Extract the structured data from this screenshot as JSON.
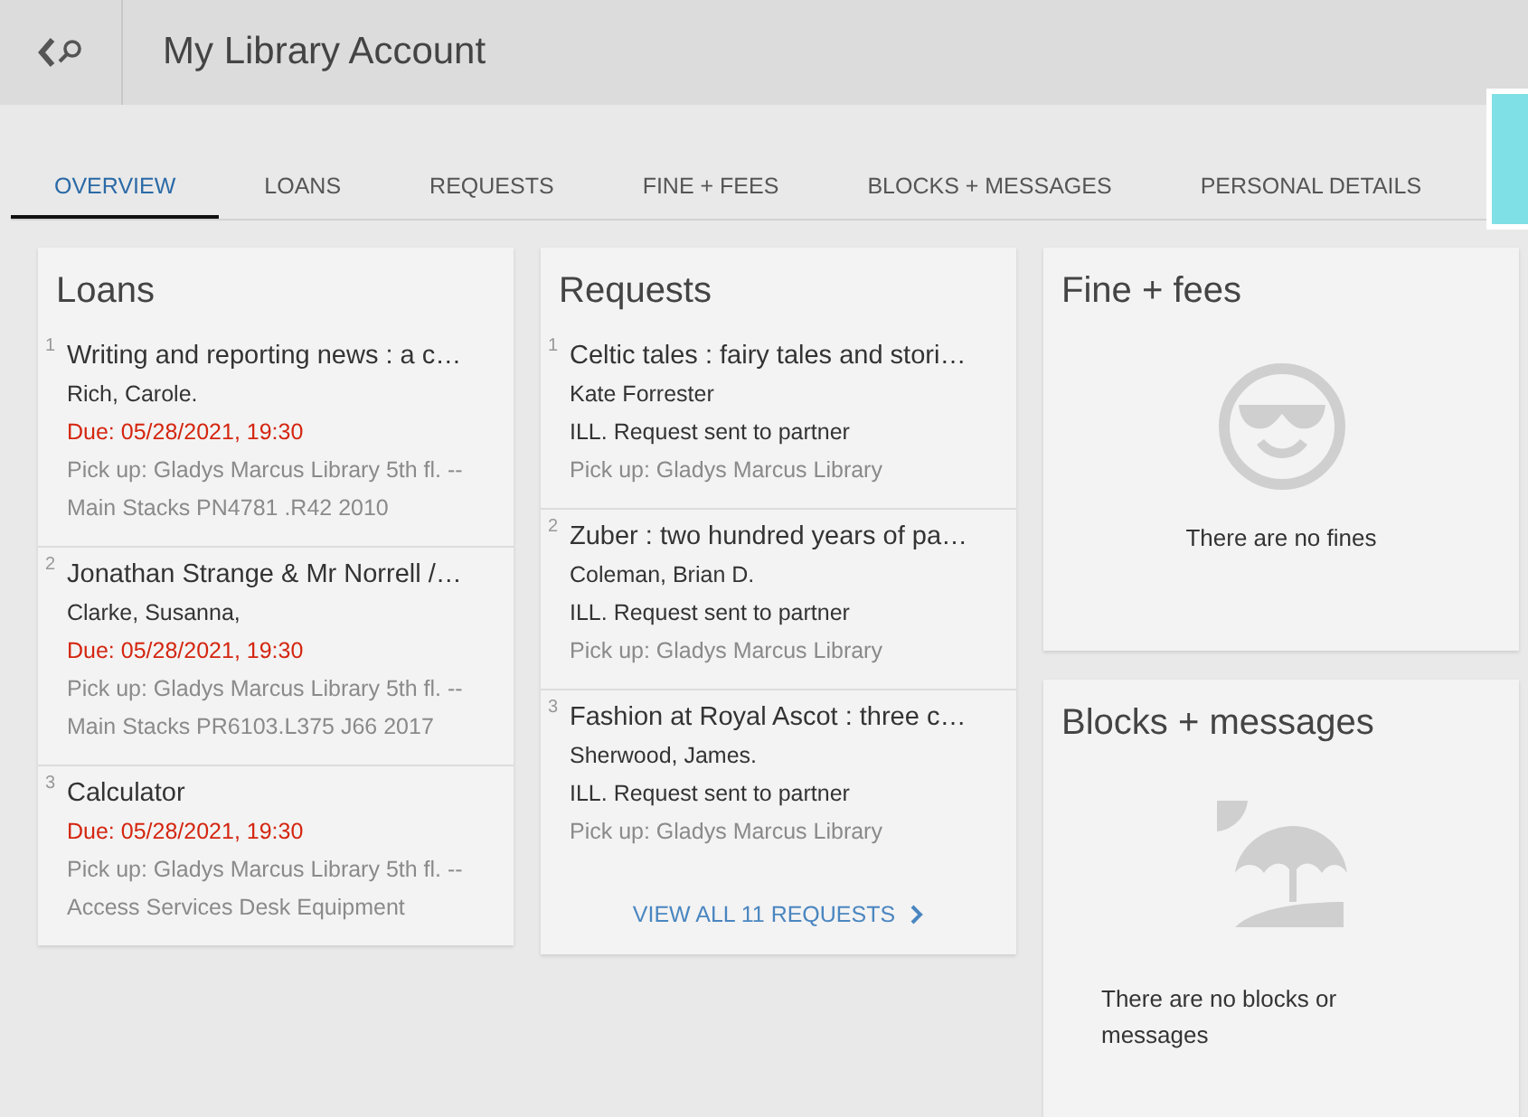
{
  "header": {
    "title": "My Library Account"
  },
  "tabs": [
    {
      "label": "OVERVIEW",
      "selected": true
    },
    {
      "label": "LOANS",
      "selected": false
    },
    {
      "label": "REQUESTS",
      "selected": false
    },
    {
      "label": "FINE + FEES",
      "selected": false
    },
    {
      "label": "BLOCKS + MESSAGES",
      "selected": false
    },
    {
      "label": "PERSONAL DETAILS",
      "selected": false
    }
  ],
  "loans": {
    "title": "Loans",
    "items": [
      {
        "number": "1",
        "title": "Writing and reporting news : a c…",
        "author": "Rich, Carole.",
        "due": "Due: 05/28/2021, 19:30",
        "pickup": "Pick up: Gladys Marcus Library 5th fl. --",
        "location": "Main Stacks PN4781 .R42 2010"
      },
      {
        "number": "2",
        "title": "Jonathan Strange & Mr Norrell /…",
        "author": "Clarke, Susanna,",
        "due": "Due: 05/28/2021, 19:30",
        "pickup": "Pick up: Gladys Marcus Library 5th fl. --",
        "location": "Main Stacks PR6103.L375 J66 2017"
      },
      {
        "number": "3",
        "title": "Calculator",
        "due": "Due: 05/28/2021, 19:30",
        "pickup": "Pick up: Gladys Marcus Library 5th fl. --",
        "location": "Access Services Desk Equipment"
      }
    ]
  },
  "requests": {
    "title": "Requests",
    "items": [
      {
        "number": "1",
        "title": "Celtic tales : fairy tales and stori…",
        "author": "Kate Forrester",
        "status": "ILL. Request sent to partner",
        "pickup": "Pick up: Gladys Marcus Library"
      },
      {
        "number": "2",
        "title": "Zuber : two hundred years of pa…",
        "author": "Coleman, Brian D.",
        "status": "ILL. Request sent to partner",
        "pickup": "Pick up: Gladys Marcus Library"
      },
      {
        "number": "3",
        "title": "Fashion at Royal Ascot : three c…",
        "author": "Sherwood, James.",
        "status": "ILL. Request sent to partner",
        "pickup": "Pick up: Gladys Marcus Library"
      }
    ],
    "view_all": "VIEW ALL 11 REQUESTS"
  },
  "fines": {
    "title": "Fine + fees",
    "message": "There are no fines"
  },
  "blocks": {
    "title": "Blocks + messages",
    "message": "There are no blocks or messages"
  }
}
